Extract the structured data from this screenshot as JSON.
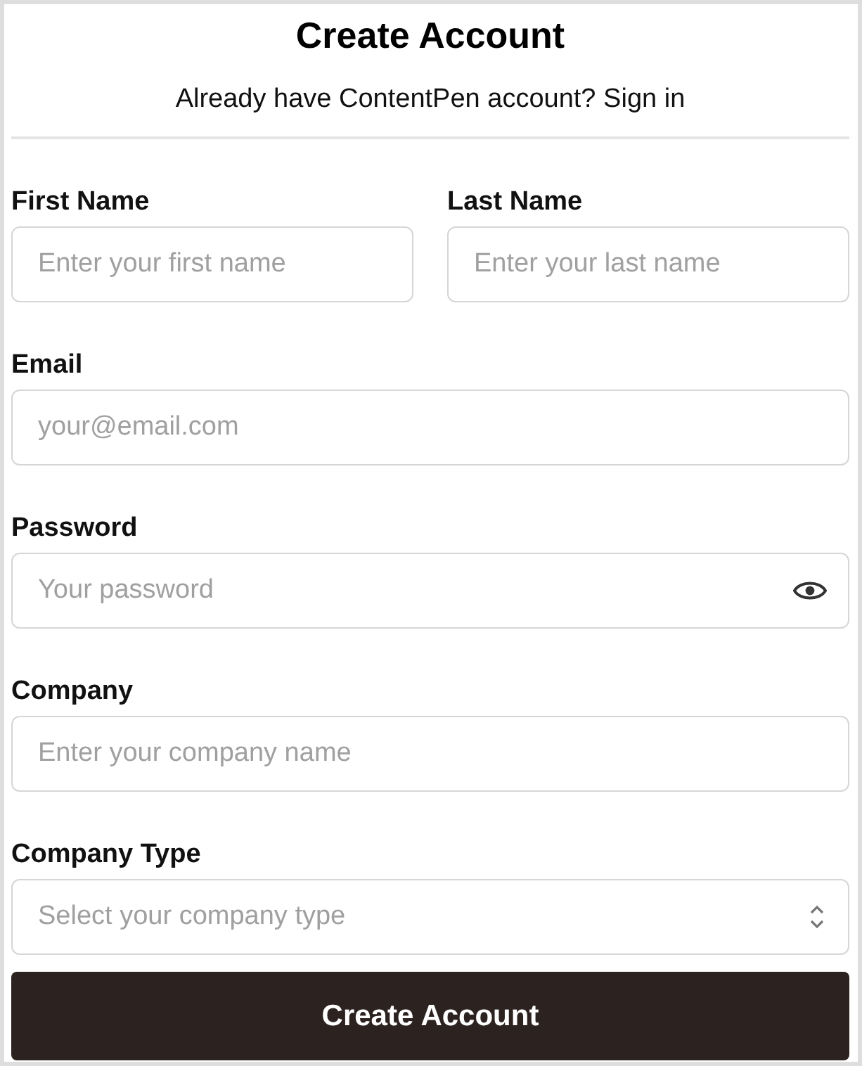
{
  "title": "Create Account",
  "signin": {
    "text": "Already have ContentPen account?",
    "link": "Sign in"
  },
  "rows": [
    {
      "fields": [
        {
          "label": "First Name",
          "placeholder": "Enter your first name",
          "kind": "text"
        },
        {
          "label": "Last Name",
          "placeholder": "Enter your last name",
          "kind": "text"
        }
      ]
    },
    {
      "fields": [
        {
          "label": "Email",
          "placeholder": "your@email.com",
          "kind": "text"
        }
      ]
    },
    {
      "fields": [
        {
          "label": "Password",
          "placeholder": "Your password",
          "kind": "password"
        }
      ]
    },
    {
      "fields": [
        {
          "label": "Company",
          "placeholder": "Enter your company name",
          "kind": "text"
        }
      ]
    },
    {
      "fields": [
        {
          "label": "Company Type",
          "placeholder": "Select your company type",
          "kind": "select"
        }
      ]
    }
  ],
  "submit": "Create Account"
}
